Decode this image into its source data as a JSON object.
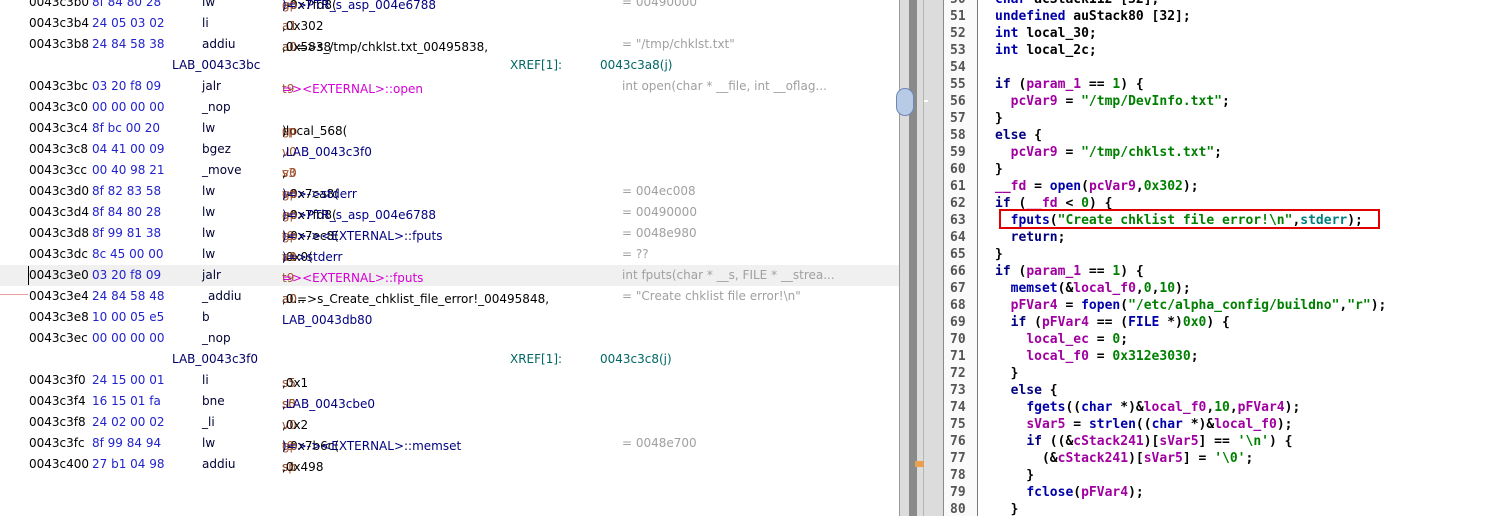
{
  "listing": {
    "rows": [
      {
        "addr": "0043c3b0",
        "bytes": "8f 84 80 28",
        "mn": "lw",
        "op": [
          {
            "t": "a0",
            "c": "reg"
          },
          {
            "t": ",-0x7fd8(",
            "c": ""
          },
          {
            "t": "gp",
            "c": "reg"
          },
          {
            "t": ")=>PTR_s_asp_004e6788",
            "c": "sym"
          }
        ],
        "cmt": "= 00490000"
      },
      {
        "addr": "0043c3b4",
        "bytes": "24 05 03 02",
        "mn": "li",
        "op": [
          {
            "t": "a1",
            "c": "reg"
          },
          {
            "t": ",0x302",
            "c": ""
          }
        ],
        "cmt": ""
      },
      {
        "addr": "0043c3b8",
        "bytes": "24 84 58 38",
        "mn": "addiu",
        "op": [
          {
            "t": "a0=>s_/tmp/chklst.txt_00495838,",
            "c": ""
          },
          {
            "t": "a0",
            "c": "reg"
          },
          {
            "t": ",0x5838",
            "c": ""
          }
        ],
        "cmt": "= \"/tmp/chklst.txt\""
      },
      {
        "label": "LAB_0043c3bc",
        "xref": "XREF[1]:",
        "xaddr": "0043c3a8(j)"
      },
      {
        "addr": "0043c3bc",
        "bytes": "03 20 f8 09",
        "mn": "jalr",
        "op": [
          {
            "t": "t9",
            "c": "reg"
          },
          {
            "t": "=><EXTERNAL>::open",
            "c": "fn"
          }
        ],
        "cmt": "int open(char * __file, int __oflag..."
      },
      {
        "addr": "0043c3c0",
        "bytes": "00 00 00 00",
        "mn": "_nop",
        "op": [],
        "cmt": ""
      },
      {
        "addr": "0043c3c4",
        "bytes": "8f bc 00 20",
        "mn": "lw",
        "op": [
          {
            "t": "gp",
            "c": "reg"
          },
          {
            "t": ",local_568(",
            "c": ""
          },
          {
            "t": "sp",
            "c": "reg"
          },
          {
            "t": ")",
            "c": ""
          }
        ],
        "cmt": ""
      },
      {
        "addr": "0043c3c8",
        "bytes": "04 41 00 09",
        "mn": "bgez",
        "op": [
          {
            "t": "v0",
            "c": "reg"
          },
          {
            "t": ",LAB_0043c3f0",
            "c": "lab"
          }
        ],
        "cmt": ""
      },
      {
        "addr": "0043c3cc",
        "bytes": "00 40 98 21",
        "mn": "_move",
        "op": [
          {
            "t": "s3",
            "c": "reg"
          },
          {
            "t": ",",
            "c": ""
          },
          {
            "t": "v0",
            "c": "reg"
          }
        ],
        "cmt": ""
      },
      {
        "addr": "0043c3d0",
        "bytes": "8f 82 83 58",
        "mn": "lw",
        "op": [
          {
            "t": "v0",
            "c": "reg"
          },
          {
            "t": ",-0x7ca8(",
            "c": ""
          },
          {
            "t": "gp",
            "c": "reg"
          },
          {
            "t": ")=>->stderr",
            "c": "sym"
          }
        ],
        "cmt": "= 004ec008"
      },
      {
        "addr": "0043c3d4",
        "bytes": "8f 84 80 28",
        "mn": "lw",
        "op": [
          {
            "t": "a0",
            "c": "reg"
          },
          {
            "t": ",-0x7fd8(",
            "c": ""
          },
          {
            "t": "gp",
            "c": "reg"
          },
          {
            "t": ")=>PTR_s_asp_004e6788",
            "c": "sym"
          }
        ],
        "cmt": "= 00490000"
      },
      {
        "addr": "0043c3d8",
        "bytes": "8f 99 81 38",
        "mn": "lw",
        "op": [
          {
            "t": "t9",
            "c": "reg"
          },
          {
            "t": ",-0x7ec8(",
            "c": ""
          },
          {
            "t": "gp",
            "c": "reg"
          },
          {
            "t": ")=>-><EXTERNAL>::fputs",
            "c": "sym"
          }
        ],
        "cmt": "= 0048e980"
      },
      {
        "addr": "0043c3dc",
        "bytes": "8c 45 00 00",
        "mn": "lw",
        "op": [
          {
            "t": "a1",
            "c": "reg"
          },
          {
            "t": ",0x0(",
            "c": ""
          },
          {
            "t": "v0",
            "c": "reg"
          },
          {
            "t": ")=>stderr",
            "c": "sym"
          }
        ],
        "cmt": "= ??"
      },
      {
        "addr": "0043c3e0",
        "bytes": "03 20 f8 09",
        "mn": "jalr",
        "op": [
          {
            "t": "t9",
            "c": "reg"
          },
          {
            "t": "=><EXTERNAL>::fputs",
            "c": "fn"
          }
        ],
        "cmt": "int fputs(char * __s, FILE * __strea...",
        "hl": true
      },
      {
        "addr": "0043c3e4",
        "bytes": "24 84 58 48",
        "mn": "_addiu",
        "op": [
          {
            "t": "a0=>s_Create_chklist_file_error!_00495848,",
            "c": ""
          },
          {
            "t": "a0",
            "c": "reg"
          },
          {
            "t": ",0...",
            "c": ""
          }
        ],
        "cmt": "= \"Create chklist file error!\\n\""
      },
      {
        "addr": "0043c3e8",
        "bytes": "10 00 05 e5",
        "mn": "b",
        "op": [
          {
            "t": "LAB_0043db80",
            "c": "lab"
          }
        ],
        "cmt": ""
      },
      {
        "addr": "0043c3ec",
        "bytes": "00 00 00 00",
        "mn": "_nop",
        "op": [],
        "cmt": ""
      },
      {
        "label": "LAB_0043c3f0",
        "xref": "XREF[1]:",
        "xaddr": "0043c3c8(j)"
      },
      {
        "addr": "0043c3f0",
        "bytes": "24 15 00 01",
        "mn": "li",
        "op": [
          {
            "t": "s5",
            "c": "reg"
          },
          {
            "t": ",0x1",
            "c": ""
          }
        ],
        "cmt": ""
      },
      {
        "addr": "0043c3f4",
        "bytes": "16 15 01 fa",
        "mn": "bne",
        "op": [
          {
            "t": "s0",
            "c": "reg"
          },
          {
            "t": ",",
            "c": ""
          },
          {
            "t": "s5",
            "c": "reg"
          },
          {
            "t": ",LAB_0043cbe0",
            "c": "lab"
          }
        ],
        "cmt": ""
      },
      {
        "addr": "0043c3f8",
        "bytes": "24 02 00 02",
        "mn": "_li",
        "op": [
          {
            "t": "v0",
            "c": "reg"
          },
          {
            "t": ",0x2",
            "c": ""
          }
        ],
        "cmt": ""
      },
      {
        "addr": "0043c3fc",
        "bytes": "8f 99 84 94",
        "mn": "lw",
        "op": [
          {
            "t": "t9",
            "c": "reg"
          },
          {
            "t": ",-0x7b6c(",
            "c": ""
          },
          {
            "t": "gp",
            "c": "reg"
          },
          {
            "t": ")=>-><EXTERNAL>::memset",
            "c": "sym"
          }
        ],
        "cmt": "= 0048e700"
      },
      {
        "addr": "0043c400",
        "bytes": "27 b1 04 98",
        "mn": "addiu",
        "op": [
          {
            "t": "s1",
            "c": "reg"
          },
          {
            "t": ",",
            "c": ""
          },
          {
            "t": "sp",
            "c": "reg"
          },
          {
            "t": ",0x498",
            "c": ""
          }
        ],
        "cmt": ""
      }
    ]
  },
  "decompiler": {
    "lines": [
      {
        "n": "50",
        "s": [
          {
            "t": "char ",
            "c": "ty"
          },
          {
            "t": "acStack112 [32];",
            "c": ""
          }
        ]
      },
      {
        "n": "51",
        "s": [
          {
            "t": "undefined ",
            "c": "ty"
          },
          {
            "t": "auStack80 [32];",
            "c": ""
          }
        ]
      },
      {
        "n": "52",
        "s": [
          {
            "t": "int ",
            "c": "ty"
          },
          {
            "t": "local_30;",
            "c": ""
          }
        ]
      },
      {
        "n": "53",
        "s": [
          {
            "t": "int ",
            "c": "ty"
          },
          {
            "t": "local_2c;",
            "c": ""
          }
        ]
      },
      {
        "n": "54",
        "s": []
      },
      {
        "n": "55",
        "s": [
          {
            "t": "if ",
            "c": "kw"
          },
          {
            "t": "(",
            "c": ""
          },
          {
            "t": "param_1",
            "c": "vr"
          },
          {
            "t": " == ",
            "c": ""
          },
          {
            "t": "1",
            "c": "nm"
          },
          {
            "t": ") {",
            "c": ""
          }
        ]
      },
      {
        "n": "56",
        "s": [
          {
            "t": "  ",
            "c": ""
          },
          {
            "t": "pcVar9",
            "c": "vr"
          },
          {
            "t": " = ",
            "c": ""
          },
          {
            "t": "\"/tmp/DevInfo.txt\"",
            "c": "st"
          },
          {
            "t": ";",
            "c": ""
          }
        ]
      },
      {
        "n": "57",
        "s": [
          {
            "t": "}",
            "c": ""
          }
        ]
      },
      {
        "n": "58",
        "s": [
          {
            "t": "else ",
            "c": "kw"
          },
          {
            "t": "{",
            "c": ""
          }
        ]
      },
      {
        "n": "59",
        "s": [
          {
            "t": "  ",
            "c": ""
          },
          {
            "t": "pcVar9",
            "c": "vr"
          },
          {
            "t": " = ",
            "c": ""
          },
          {
            "t": "\"/tmp/chklst.txt\"",
            "c": "st"
          },
          {
            "t": ";",
            "c": ""
          }
        ]
      },
      {
        "n": "60",
        "s": [
          {
            "t": "}",
            "c": ""
          }
        ]
      },
      {
        "n": "61",
        "s": [
          {
            "t": "__fd",
            "c": "vr"
          },
          {
            "t": " = ",
            "c": ""
          },
          {
            "t": "open",
            "c": "fc"
          },
          {
            "t": "(",
            "c": ""
          },
          {
            "t": "pcVar9",
            "c": "vr"
          },
          {
            "t": ",",
            "c": ""
          },
          {
            "t": "0x302",
            "c": "nm"
          },
          {
            "t": ");",
            "c": ""
          }
        ]
      },
      {
        "n": "62",
        "s": [
          {
            "t": "if ",
            "c": "kw"
          },
          {
            "t": "(",
            "c": ""
          },
          {
            "t": "__fd",
            "c": "vr"
          },
          {
            "t": " < ",
            "c": ""
          },
          {
            "t": "0",
            "c": "nm"
          },
          {
            "t": ") {",
            "c": ""
          }
        ]
      },
      {
        "n": "63",
        "s": [
          {
            "t": "  ",
            "c": ""
          },
          {
            "t": "fputs",
            "c": "fc"
          },
          {
            "t": "(",
            "c": ""
          },
          {
            "t": "\"Create chklist file error!\\n\"",
            "c": "st"
          },
          {
            "t": ",",
            "c": ""
          },
          {
            "t": "stderr",
            "c": "gl"
          },
          {
            "t": ");",
            "c": ""
          }
        ]
      },
      {
        "n": "64",
        "s": [
          {
            "t": "  ",
            "c": ""
          },
          {
            "t": "return",
            "c": "kw"
          },
          {
            "t": ";",
            "c": ""
          }
        ]
      },
      {
        "n": "65",
        "s": [
          {
            "t": "}",
            "c": ""
          }
        ]
      },
      {
        "n": "66",
        "s": [
          {
            "t": "if ",
            "c": "kw"
          },
          {
            "t": "(",
            "c": ""
          },
          {
            "t": "param_1",
            "c": "vr"
          },
          {
            "t": " == ",
            "c": ""
          },
          {
            "t": "1",
            "c": "nm"
          },
          {
            "t": ") {",
            "c": ""
          }
        ]
      },
      {
        "n": "67",
        "s": [
          {
            "t": "  ",
            "c": ""
          },
          {
            "t": "memset",
            "c": "fc"
          },
          {
            "t": "(&",
            "c": ""
          },
          {
            "t": "local_f0",
            "c": "vr"
          },
          {
            "t": ",",
            "c": ""
          },
          {
            "t": "0",
            "c": "nm"
          },
          {
            "t": ",",
            "c": ""
          },
          {
            "t": "10",
            "c": "nm"
          },
          {
            "t": ");",
            "c": ""
          }
        ]
      },
      {
        "n": "68",
        "s": [
          {
            "t": "  ",
            "c": ""
          },
          {
            "t": "pFVar4",
            "c": "vr"
          },
          {
            "t": " = ",
            "c": ""
          },
          {
            "t": "fopen",
            "c": "fc"
          },
          {
            "t": "(",
            "c": ""
          },
          {
            "t": "\"/etc/alpha_config/buildno\"",
            "c": "st"
          },
          {
            "t": ",",
            "c": ""
          },
          {
            "t": "\"r\"",
            "c": "st"
          },
          {
            "t": ");",
            "c": ""
          }
        ]
      },
      {
        "n": "69",
        "s": [
          {
            "t": "  ",
            "c": ""
          },
          {
            "t": "if ",
            "c": "kw"
          },
          {
            "t": "(",
            "c": ""
          },
          {
            "t": "pFVar4",
            "c": "vr"
          },
          {
            "t": " == (",
            "c": ""
          },
          {
            "t": "FILE",
            "c": "ty"
          },
          {
            "t": " *)",
            "c": ""
          },
          {
            "t": "0x0",
            "c": "nm"
          },
          {
            "t": ") {",
            "c": ""
          }
        ]
      },
      {
        "n": "70",
        "s": [
          {
            "t": "    ",
            "c": ""
          },
          {
            "t": "local_ec",
            "c": "vr"
          },
          {
            "t": " = ",
            "c": ""
          },
          {
            "t": "0",
            "c": "nm"
          },
          {
            "t": ";",
            "c": ""
          }
        ]
      },
      {
        "n": "71",
        "s": [
          {
            "t": "    ",
            "c": ""
          },
          {
            "t": "local_f0",
            "c": "vr"
          },
          {
            "t": " = ",
            "c": ""
          },
          {
            "t": "0x312e3030",
            "c": "nm"
          },
          {
            "t": ";",
            "c": ""
          }
        ]
      },
      {
        "n": "72",
        "s": [
          {
            "t": "  }",
            "c": ""
          }
        ]
      },
      {
        "n": "73",
        "s": [
          {
            "t": "  ",
            "c": ""
          },
          {
            "t": "else ",
            "c": "kw"
          },
          {
            "t": "{",
            "c": ""
          }
        ]
      },
      {
        "n": "74",
        "s": [
          {
            "t": "    ",
            "c": ""
          },
          {
            "t": "fgets",
            "c": "fc"
          },
          {
            "t": "((",
            "c": ""
          },
          {
            "t": "char",
            "c": "ty"
          },
          {
            "t": " *)&",
            "c": ""
          },
          {
            "t": "local_f0",
            "c": "vr"
          },
          {
            "t": ",",
            "c": ""
          },
          {
            "t": "10",
            "c": "nm"
          },
          {
            "t": ",",
            "c": ""
          },
          {
            "t": "pFVar4",
            "c": "vr"
          },
          {
            "t": ");",
            "c": ""
          }
        ]
      },
      {
        "n": "75",
        "s": [
          {
            "t": "    ",
            "c": ""
          },
          {
            "t": "sVar5",
            "c": "vr"
          },
          {
            "t": " = ",
            "c": ""
          },
          {
            "t": "strlen",
            "c": "fc"
          },
          {
            "t": "((",
            "c": ""
          },
          {
            "t": "char",
            "c": "ty"
          },
          {
            "t": " *)&",
            "c": ""
          },
          {
            "t": "local_f0",
            "c": "vr"
          },
          {
            "t": ");",
            "c": ""
          }
        ]
      },
      {
        "n": "76",
        "s": [
          {
            "t": "    ",
            "c": ""
          },
          {
            "t": "if ",
            "c": "kw"
          },
          {
            "t": "((&",
            "c": ""
          },
          {
            "t": "cStack241",
            "c": "vr"
          },
          {
            "t": ")[",
            "c": ""
          },
          {
            "t": "sVar5",
            "c": "vr"
          },
          {
            "t": "] == ",
            "c": ""
          },
          {
            "t": "'\\n'",
            "c": "st"
          },
          {
            "t": ") {",
            "c": ""
          }
        ]
      },
      {
        "n": "77",
        "s": [
          {
            "t": "      (&",
            "c": ""
          },
          {
            "t": "cStack241",
            "c": "vr"
          },
          {
            "t": ")[",
            "c": ""
          },
          {
            "t": "sVar5",
            "c": "vr"
          },
          {
            "t": "] = ",
            "c": ""
          },
          {
            "t": "'\\0'",
            "c": "st"
          },
          {
            "t": ";",
            "c": ""
          }
        ]
      },
      {
        "n": "78",
        "s": [
          {
            "t": "    }",
            "c": ""
          }
        ]
      },
      {
        "n": "79",
        "s": [
          {
            "t": "    ",
            "c": ""
          },
          {
            "t": "fclose",
            "c": "fc"
          },
          {
            "t": "(",
            "c": ""
          },
          {
            "t": "pFVar4",
            "c": "vr"
          },
          {
            "t": ");",
            "c": ""
          }
        ]
      },
      {
        "n": "80",
        "s": [
          {
            "t": "  }",
            "c": ""
          }
        ]
      }
    ]
  }
}
